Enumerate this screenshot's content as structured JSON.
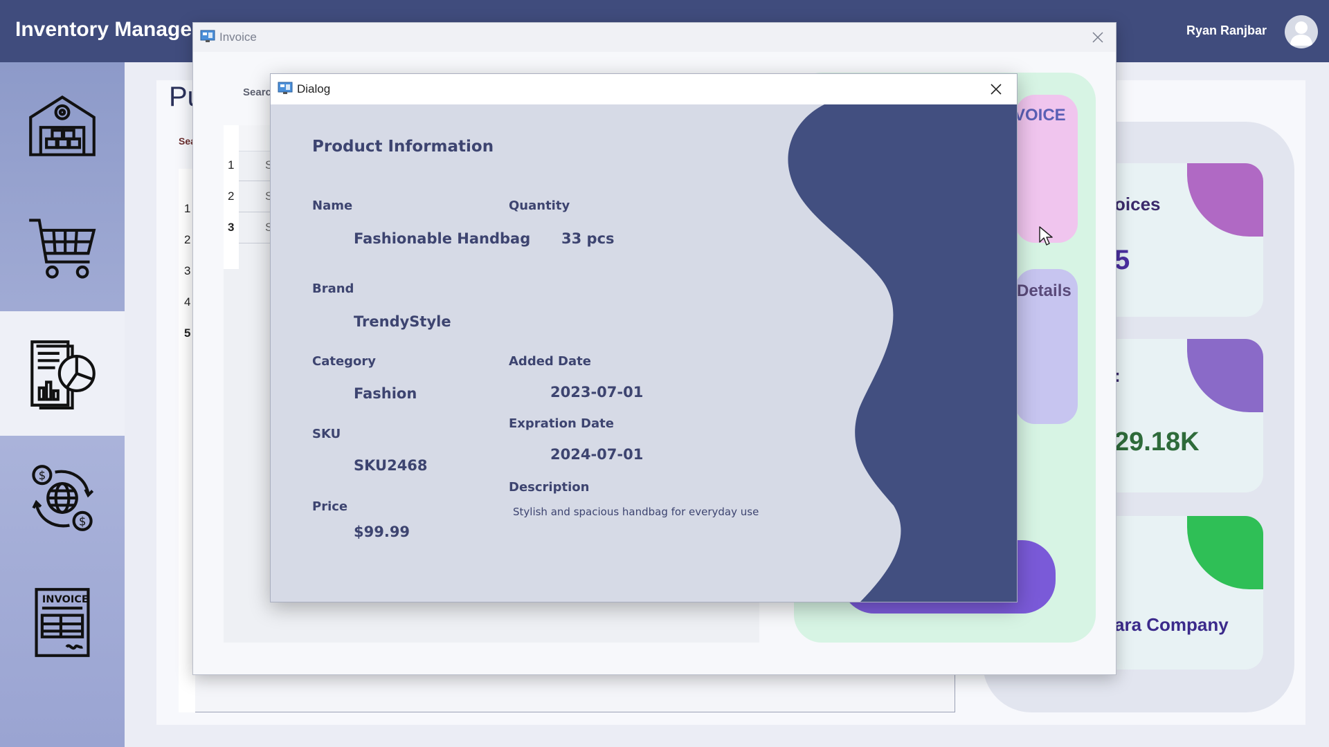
{
  "app": {
    "title": "Inventory Manage",
    "user_name": "Ryan Ranjbar"
  },
  "sidebar": {
    "items": [
      {
        "icon": "warehouse-icon"
      },
      {
        "icon": "shopping-cart-icon"
      },
      {
        "icon": "report-chart-icon",
        "active": true
      },
      {
        "icon": "currency-exchange-icon"
      },
      {
        "icon": "invoice-icon"
      }
    ]
  },
  "background": {
    "page_title": "Pu",
    "search_label": "Sea",
    "row_numbers": [
      "1",
      "2",
      "3",
      "4",
      "5"
    ],
    "cards": {
      "invoices_label": "oices",
      "invoices_value": "5",
      "amount_label": ":",
      "amount_value": "29.18K",
      "company_value": "ara Company"
    }
  },
  "invoice_window": {
    "title": "Invoice",
    "search_label": "Searc",
    "row_numbers": [
      "1",
      "2",
      "3"
    ],
    "row_prefixes": [
      "S",
      "S",
      "S"
    ],
    "card_invoice_label": "VOICE",
    "card_details_label": "Details"
  },
  "dialog": {
    "title": "Dialog",
    "heading": "Product Information",
    "fields": {
      "name_label": "Name",
      "name_value": "Fashionable Handbag",
      "quantity_label": "Quantity",
      "quantity_value": "33 pcs",
      "brand_label": "Brand",
      "brand_value": "TrendyStyle",
      "category_label": "Category",
      "category_value": "Fashion",
      "added_date_label": "Added Date",
      "added_date_value": "2023-07-01",
      "sku_label": "SKU",
      "sku_value": "SKU2468",
      "expiration_label": "Expration Date",
      "expiration_value": "2024-07-01",
      "description_label": "Description",
      "description_value": "Stylish and spacious handbag for everyday use",
      "price_label": "Price",
      "price_value": "$99.99"
    }
  },
  "colors": {
    "header": "#404c7d",
    "dialog_bg": "#d6dae6",
    "wave": "#424f80",
    "text": "#3d4470"
  }
}
